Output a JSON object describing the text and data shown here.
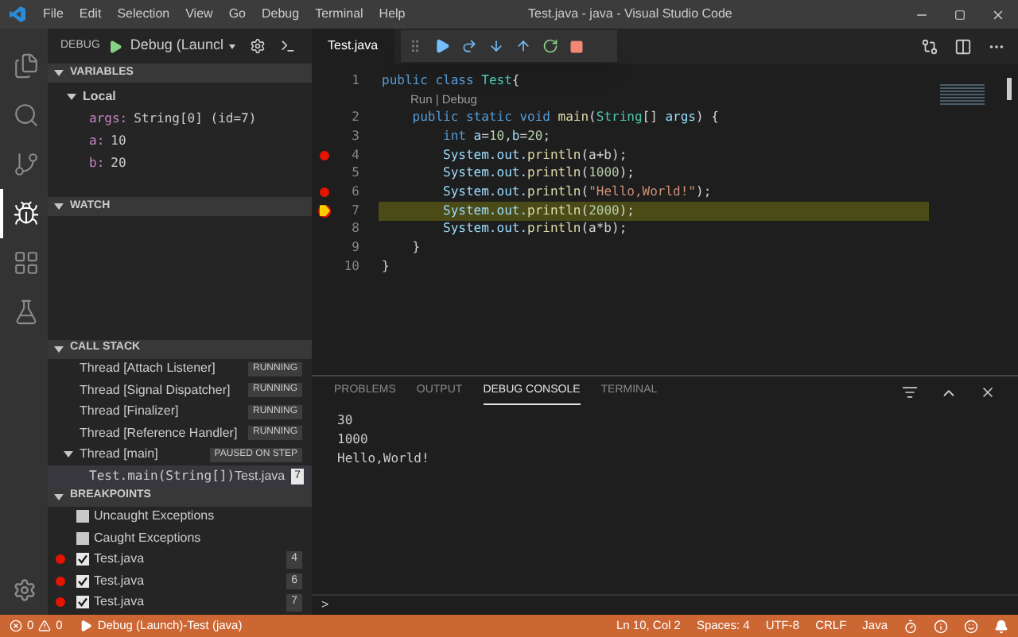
{
  "window": {
    "title": "Test.java - java - Visual Studio Code"
  },
  "menu": [
    "File",
    "Edit",
    "Selection",
    "View",
    "Go",
    "Debug",
    "Terminal",
    "Help"
  ],
  "activity_bar": [
    {
      "kind": "files",
      "selected": false
    },
    {
      "kind": "search",
      "selected": false
    },
    {
      "kind": "git",
      "selected": false
    },
    {
      "kind": "debug",
      "selected": true
    },
    {
      "kind": "extensions",
      "selected": false
    },
    {
      "kind": "flask",
      "selected": false
    }
  ],
  "debug_header": {
    "label": "DEBUG",
    "configuration": "Debug (Launcl"
  },
  "variables": {
    "title": "VARIABLES",
    "scope": {
      "label": "Local",
      "expanded": true,
      "children": [
        {
          "name": "args:",
          "value": "String[0] (id=7)"
        },
        {
          "name": "a:",
          "value": "10"
        },
        {
          "name": "b:",
          "value": "20"
        }
      ]
    }
  },
  "watch": {
    "title": "WATCH"
  },
  "call_stack": {
    "title": "CALL STACK",
    "threads": [
      {
        "name": "Thread [Attach Listener]",
        "state": "RUNNING",
        "expanded": false
      },
      {
        "name": "Thread [Signal Dispatcher]",
        "state": "RUNNING",
        "expanded": false
      },
      {
        "name": "Thread [Finalizer]",
        "state": "RUNNING",
        "expanded": false
      },
      {
        "name": "Thread [Reference Handler]",
        "state": "RUNNING",
        "expanded": false
      },
      {
        "name": "Thread [main]",
        "state": "PAUSED ON STEP",
        "expanded": true,
        "children": [
          {
            "name": "Test.main(String[])",
            "file": "Test.java",
            "line": "7"
          }
        ]
      }
    ]
  },
  "breakpoints": {
    "title": "BREAKPOINTS",
    "items": [
      {
        "kind": "exception",
        "label": "Uncaught Exceptions",
        "checked": false
      },
      {
        "kind": "exception",
        "label": "Caught Exceptions",
        "checked": false
      },
      {
        "kind": "file",
        "label": "Test.java",
        "checked": true,
        "line": "4"
      },
      {
        "kind": "file",
        "label": "Test.java",
        "checked": true,
        "line": "6"
      },
      {
        "kind": "file",
        "label": "Test.java",
        "checked": true,
        "line": "7"
      }
    ]
  },
  "editor": {
    "tab": {
      "label": "Test.java",
      "selected": true
    },
    "lines": [
      {
        "kind": "code",
        "number": "1",
        "breakpoint": false,
        "current": false,
        "tokens": [
          {
            "text": "public class ",
            "kind": "keyword"
          },
          {
            "text": "Test",
            "kind": "type"
          },
          {
            "text": "{",
            "kind": "plain"
          }
        ]
      },
      {
        "kind": "codelens",
        "text": "Run | Debug"
      },
      {
        "kind": "code",
        "number": "2",
        "breakpoint": false,
        "current": false,
        "tokens": [
          {
            "text": "    public static void ",
            "kind": "keyword"
          },
          {
            "text": "main",
            "kind": "func"
          },
          {
            "text": "(",
            "kind": "plain"
          },
          {
            "text": "String",
            "kind": "type"
          },
          {
            "text": "[] ",
            "kind": "plain"
          },
          {
            "text": "args",
            "kind": "var"
          },
          {
            "text": ") {",
            "kind": "plain"
          }
        ]
      },
      {
        "kind": "code",
        "number": "3",
        "breakpoint": false,
        "current": false,
        "tokens": [
          {
            "text": "        int ",
            "kind": "keyword"
          },
          {
            "text": "a",
            "kind": "var"
          },
          {
            "text": "=",
            "kind": "plain"
          },
          {
            "text": "10",
            "kind": "number"
          },
          {
            "text": ",",
            "kind": "plain"
          },
          {
            "text": "b",
            "kind": "var"
          },
          {
            "text": "=",
            "kind": "plain"
          },
          {
            "text": "20",
            "kind": "number"
          },
          {
            "text": ";",
            "kind": "plain"
          }
        ]
      },
      {
        "kind": "code",
        "number": "4",
        "breakpoint": true,
        "current": false,
        "tokens": [
          {
            "text": "        System.out.",
            "kind": "var"
          },
          {
            "text": "println",
            "kind": "func"
          },
          {
            "text": "(a+b);",
            "kind": "plain"
          }
        ]
      },
      {
        "kind": "code",
        "number": "5",
        "breakpoint": false,
        "current": false,
        "tokens": [
          {
            "text": "        System.out.",
            "kind": "var"
          },
          {
            "text": "println",
            "kind": "func"
          },
          {
            "text": "(",
            "kind": "plain"
          },
          {
            "text": "1000",
            "kind": "number"
          },
          {
            "text": ");",
            "kind": "plain"
          }
        ]
      },
      {
        "kind": "code",
        "number": "6",
        "breakpoint": true,
        "current": false,
        "tokens": [
          {
            "text": "        System.out.",
            "kind": "var"
          },
          {
            "text": "println",
            "kind": "func"
          },
          {
            "text": "(",
            "kind": "plain"
          },
          {
            "text": "\"Hello,World!\"",
            "kind": "string"
          },
          {
            "text": ");",
            "kind": "plain"
          }
        ]
      },
      {
        "kind": "code",
        "number": "7",
        "breakpoint": true,
        "current": true,
        "tokens": [
          {
            "text": "        System.out.",
            "kind": "var"
          },
          {
            "text": "println",
            "kind": "func"
          },
          {
            "text": "(",
            "kind": "plain"
          },
          {
            "text": "2000",
            "kind": "number"
          },
          {
            "text": ");",
            "kind": "plain"
          }
        ]
      },
      {
        "kind": "code",
        "number": "8",
        "breakpoint": false,
        "current": false,
        "tokens": [
          {
            "text": "        System.out.",
            "kind": "var"
          },
          {
            "text": "println",
            "kind": "func"
          },
          {
            "text": "(a*b);",
            "kind": "plain"
          }
        ]
      },
      {
        "kind": "code",
        "number": "9",
        "breakpoint": false,
        "current": false,
        "tokens": [
          {
            "text": "    }",
            "kind": "plain"
          }
        ]
      },
      {
        "kind": "code",
        "number": "10",
        "breakpoint": false,
        "current": false,
        "tokens": [
          {
            "text": "}",
            "kind": "plain"
          }
        ]
      }
    ]
  },
  "panel": {
    "tabs": [
      {
        "label": "PROBLEMS",
        "selected": false
      },
      {
        "label": "OUTPUT",
        "selected": false
      },
      {
        "label": "DEBUG CONSOLE",
        "selected": true
      },
      {
        "label": "TERMINAL",
        "selected": false
      }
    ],
    "output": [
      "30",
      "1000",
      "Hello,World!"
    ],
    "prompt": ">"
  },
  "status_bar": {
    "errors": "0",
    "warnings": "0",
    "launch": "Debug (Launch)-Test (java)",
    "right": [
      "Ln 10, Col 2",
      "Spaces: 4",
      "UTF-8",
      "CRLF",
      "Java"
    ]
  }
}
